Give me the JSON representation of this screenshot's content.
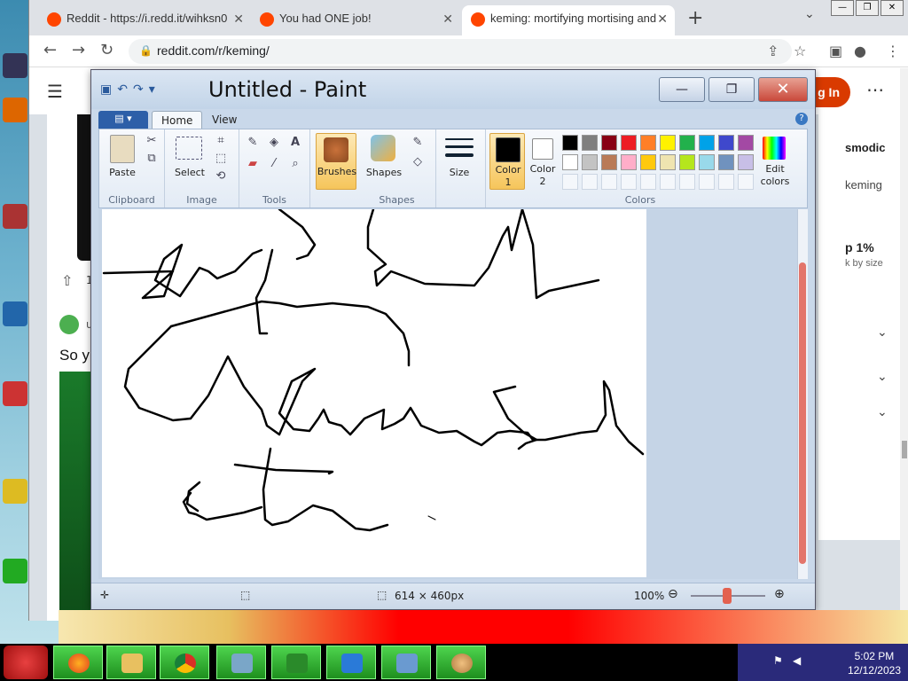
{
  "browser": {
    "tabs": [
      {
        "label": "Reddit - https://i.redd.it/wihksn0"
      },
      {
        "label": "You had ONE job!"
      },
      {
        "label": "keming: mortifying mortising and"
      }
    ],
    "url": "reddit.com/r/keming/"
  },
  "reddit": {
    "login_label": "g In",
    "upvote_count": "1",
    "post_user": "u",
    "post_text": "So y",
    "side_title": "smodic",
    "side_sub": "keming",
    "side_pct": "p 1%",
    "side_link": "k by size"
  },
  "paint": {
    "title": "Untitled - Paint",
    "tabs": {
      "home": "Home",
      "view": "View"
    },
    "groups": {
      "clipboard": "Clipboard",
      "image": "Image",
      "tools": "Tools",
      "shapes": "Shapes",
      "colors": "Colors"
    },
    "buttons": {
      "paste": "Paste",
      "select": "Select",
      "brushes": "Brushes",
      "shapes": "Shapes",
      "size": "Size",
      "color1_line1": "Color",
      "color1_line2": "1",
      "color2_line1": "Color",
      "color2_line2": "2",
      "edit_colors_line1": "Edit",
      "edit_colors_line2": "colors"
    },
    "palette_row1": [
      "#000000",
      "#7f7f7f",
      "#880015",
      "#ed1c24",
      "#ff7f27",
      "#fff200",
      "#22b14c",
      "#00a2e8",
      "#3f48cc",
      "#a349a4"
    ],
    "palette_row2": [
      "#ffffff",
      "#c3c3c3",
      "#b97a57",
      "#ffaec9",
      "#ffc90e",
      "#efe4b0",
      "#b5e61d",
      "#99d9ea",
      "#7092be",
      "#c8bfe7"
    ],
    "color1": "#000000",
    "color2": "#ffffff",
    "status": {
      "dimensions": "614 × 460px",
      "zoom": "100%"
    }
  },
  "taskbar": {
    "time": "5:02 PM",
    "date": "12/12/2023"
  }
}
